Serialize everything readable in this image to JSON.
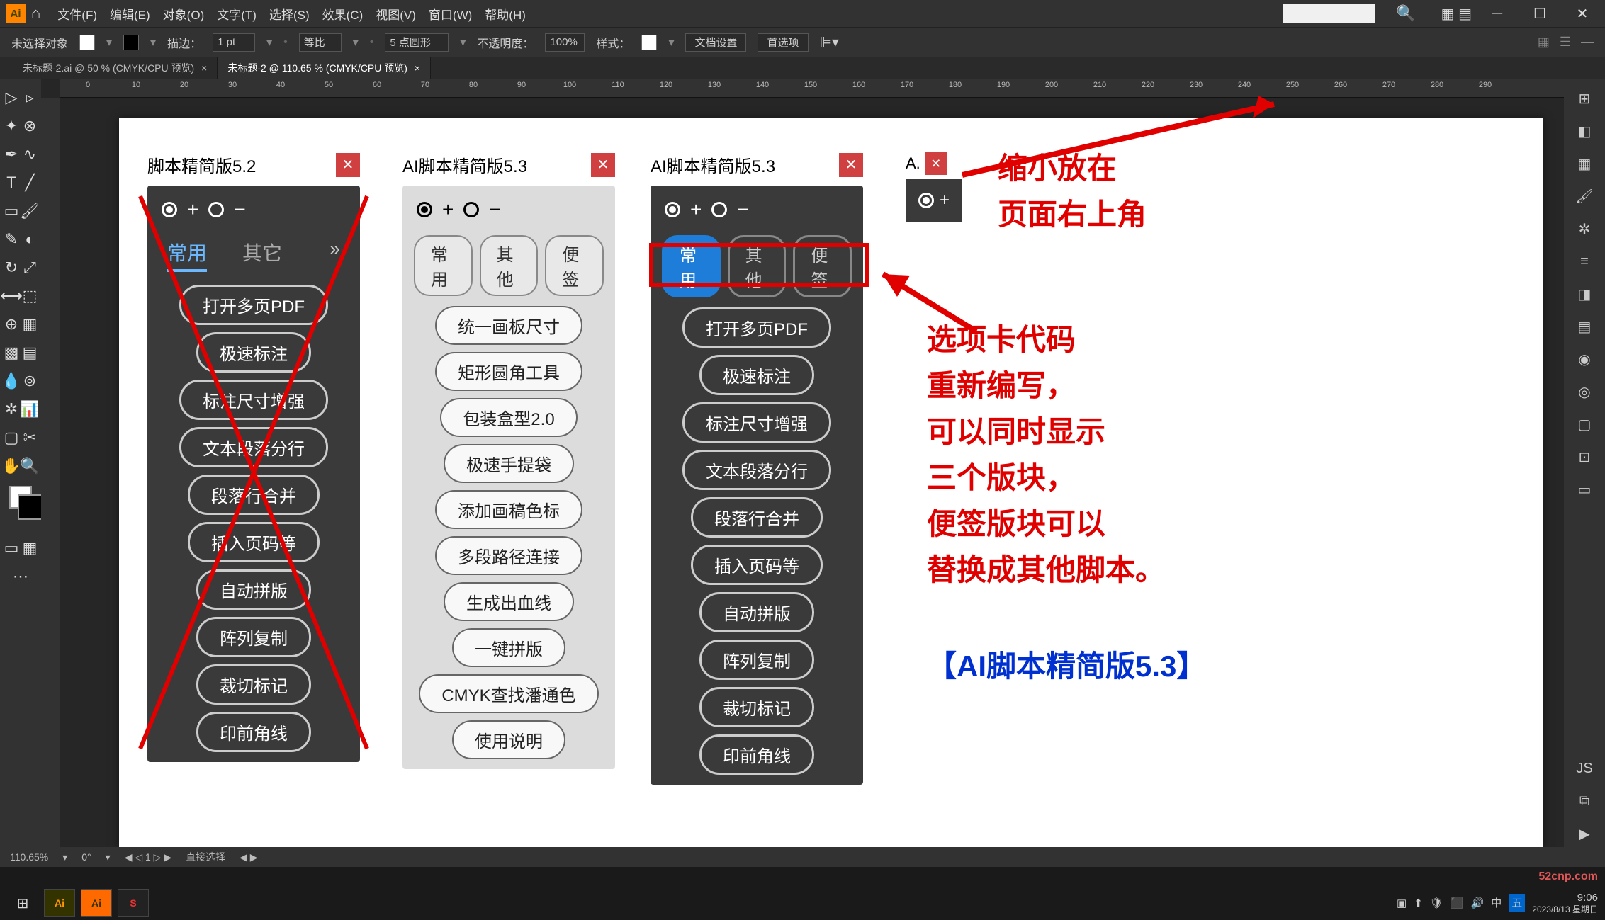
{
  "menubar": {
    "file": "文件(F)",
    "edit": "编辑(E)",
    "object": "对象(O)",
    "text": "文字(T)",
    "select": "选择(S)",
    "effect": "效果(C)",
    "view": "视图(V)",
    "window": "窗口(W)",
    "help": "帮助(H)"
  },
  "controlbar": {
    "noSel": "未选择对象",
    "stroke": "描边：",
    "strokeVal": "1 pt",
    "uniform": "等比",
    "ptRound": "5 点圆形",
    "opacity": "不透明度：",
    "opacityVal": "100%",
    "style": "样式：",
    "docSetup": "文档设置",
    "prefs": "首选项"
  },
  "tabs": {
    "t1": "未标题-2.ai @ 50 % (CMYK/CPU 预览)",
    "t2": "未标题-2 @ 110.65 % (CMYK/CPU 预览)"
  },
  "ruler": {
    "marks": [
      "0",
      "10",
      "20",
      "30",
      "40",
      "50",
      "60",
      "70",
      "80",
      "90",
      "100",
      "110",
      "120",
      "130",
      "140",
      "150",
      "160",
      "170",
      "180",
      "190",
      "200",
      "210",
      "220",
      "230",
      "240",
      "250",
      "260",
      "270",
      "280",
      "290"
    ]
  },
  "panel52": {
    "title": "脚本精简版5.2",
    "tabs": [
      "常用",
      "其它"
    ],
    "items": [
      "打开多页PDF",
      "极速标注",
      "标注尺寸增强",
      "文本段落分行",
      "段落行合并",
      "插入页码等",
      "自动拼版",
      "阵列复制",
      "裁切标记",
      "印前角线"
    ]
  },
  "panel53light": {
    "title": "AI脚本精简版5.3",
    "tabs": [
      "常用",
      "其他",
      "便签"
    ],
    "items": [
      "统一画板尺寸",
      "矩形圆角工具",
      "包装盒型2.0",
      "极速手提袋",
      "添加画稿色标",
      "多段路径连接",
      "生成出血线",
      "一键拼版",
      "CMYK查找潘通色",
      "使用说明"
    ]
  },
  "panel53dark": {
    "title": "AI脚本精简版5.3",
    "tabs": [
      "常用",
      "其他",
      "便签"
    ],
    "items": [
      "打开多页PDF",
      "极速标注",
      "标注尺寸增强",
      "文本段落分行",
      "段落行合并",
      "插入页码等",
      "自动拼版",
      "阵列复制",
      "裁切标记",
      "印前角线"
    ]
  },
  "mini": {
    "label": "A."
  },
  "anno": {
    "l1": "缩小放在",
    "l2": "页面右上角",
    "b1": "选项卡代码",
    "b2": "重新编写，",
    "b3": "可以同时显示",
    "b4": "三个版块，",
    "b5": "便签版块可以",
    "b6": "替换成其他脚本。",
    "brand": "【AI脚本精简版5.3】"
  },
  "status": {
    "zoom": "110.65%",
    "angle": "0°",
    "page": "1",
    "mode": "直接选择"
  },
  "taskbar": {
    "time": "9:06",
    "date": "2023/8/13 星期日"
  },
  "watermark": "52cnp.com",
  "toggles": {
    "plus": "+",
    "minus": "−"
  }
}
